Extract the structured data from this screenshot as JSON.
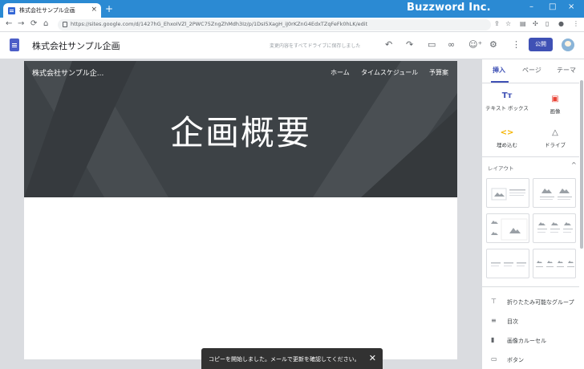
{
  "browser": {
    "tab_title": "株式会社サンプル企画",
    "tab_close": "×",
    "new_tab": "+",
    "brand": "Buzzword Inc.",
    "window_controls": {
      "minimize": "–",
      "maximize": "□",
      "close": "×"
    },
    "nav": {
      "back": "←",
      "forward": "→",
      "reload": "⟳",
      "home": "⌂"
    },
    "url": "https://sites.google.com/d/1427hG_EhxoIVZl_2PWC75ZngZhMdh3Iz/p/1DsI5XagH_iJ0rKZnG4EdxTZqFeFk0hLK/edit",
    "extension_icons": [
      "share-icon",
      "star-icon",
      "extension-icon",
      "puzzle-icon",
      "sidebar-icon",
      "profile-icon",
      "kebab-icon"
    ]
  },
  "sites_toolbar": {
    "title": "株式会社サンプル企画",
    "save_status": "変更内容をすべてドライブに保存しました",
    "publish_label": "公開",
    "icons": {
      "undo": "↶",
      "redo": "↷",
      "preview": "▭",
      "link": "∞",
      "add_editor": "⁺",
      "settings": "⚙",
      "more": "⋮"
    }
  },
  "site": {
    "site_name": "株式会社サンプル企...",
    "nav_items": [
      "ホーム",
      "タイムスケジュール",
      "予算案"
    ],
    "hero_title": "企画概要"
  },
  "panel": {
    "tabs": [
      "挿入",
      "ページ",
      "テーマ"
    ],
    "insert_items": [
      {
        "label": "テキスト ボックス",
        "icon": "text-box-icon",
        "glyph": "Tт"
      },
      {
        "label": "画像",
        "icon": "image-icon",
        "glyph": "▣"
      },
      {
        "label": "埋め込む",
        "icon": "embed-icon",
        "glyph": "<>"
      },
      {
        "label": "ドライブ",
        "icon": "drive-icon",
        "glyph": "△"
      }
    ],
    "layout_title": "レイアウト",
    "layout_caret": "^",
    "components": [
      {
        "label": "折りたたみ可能なグループ",
        "icon": "collapsible-group-icon",
        "glyph": "⊤"
      },
      {
        "label": "目次",
        "icon": "toc-icon",
        "glyph": "≡"
      },
      {
        "label": "画像カルーセル",
        "icon": "carousel-icon",
        "glyph": "▮"
      },
      {
        "label": "ボタン",
        "icon": "button-icon",
        "glyph": "▭"
      }
    ]
  },
  "snackbar": {
    "message": "コピーを開始しました。メールで更新を確認してください。",
    "close": "✕"
  },
  "colors": {
    "chrome_blue": "#2b8ad3",
    "accent": "#3f51b5",
    "hero_bg": "#3d4246",
    "snackbar_bg": "#323232"
  }
}
